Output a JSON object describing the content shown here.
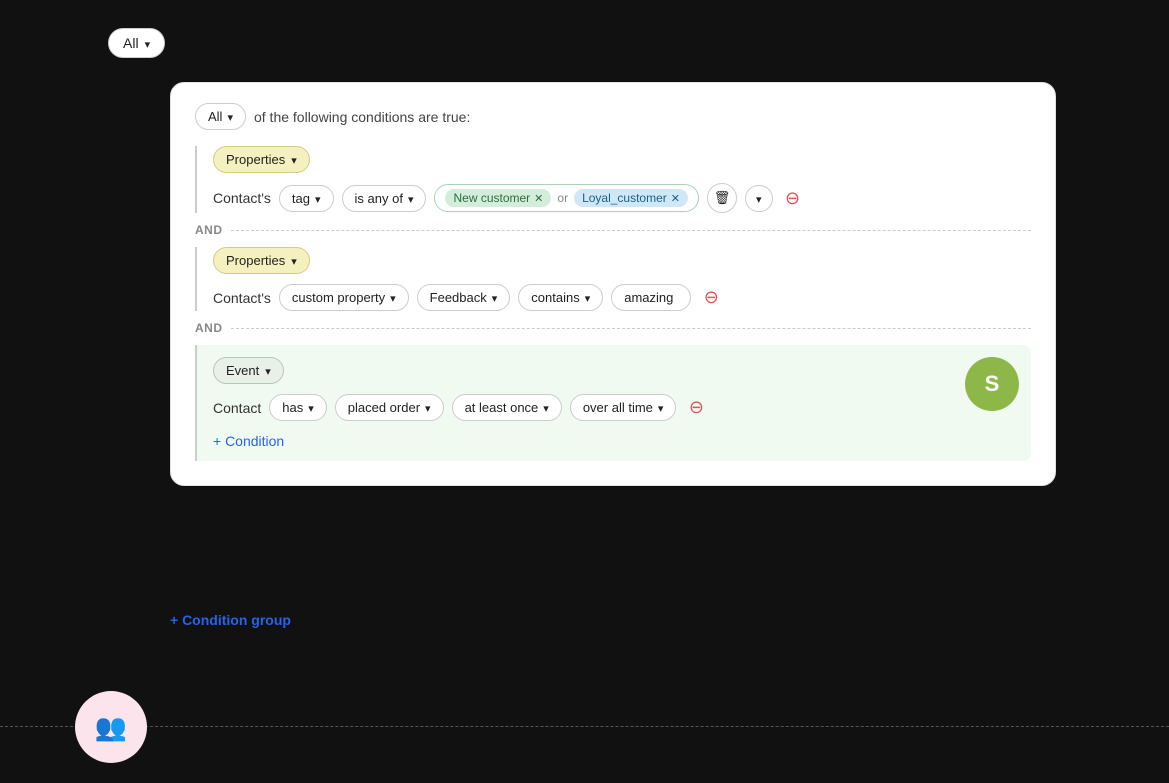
{
  "topDropdown": {
    "label": "All",
    "chevron": "▾"
  },
  "header": {
    "allLabel": "All",
    "followingText": "of the following conditions are true:"
  },
  "andLabels": [
    "AND",
    "AND"
  ],
  "block1": {
    "typeLabel": "Properties",
    "conditionLabel": "Contact's",
    "field1": "tag",
    "field2": "is any of",
    "tag1": "New customer",
    "orText": "or",
    "tag2": "Loyal_customer"
  },
  "block2": {
    "typeLabel": "Properties",
    "conditionLabel": "Contact's",
    "field1": "custom property",
    "field2": "Feedback",
    "field3": "contains",
    "field4": "amazing"
  },
  "block3": {
    "typeLabel": "Event",
    "conditionLabel": "Contact",
    "field1": "has",
    "field2": "placed order",
    "field3": "at least once",
    "field4": "over all time"
  },
  "addCondition": "+ Condition",
  "addConditionGroup": "+ Condition group",
  "shopifyIcon": "S",
  "avatarIcon": "👥"
}
